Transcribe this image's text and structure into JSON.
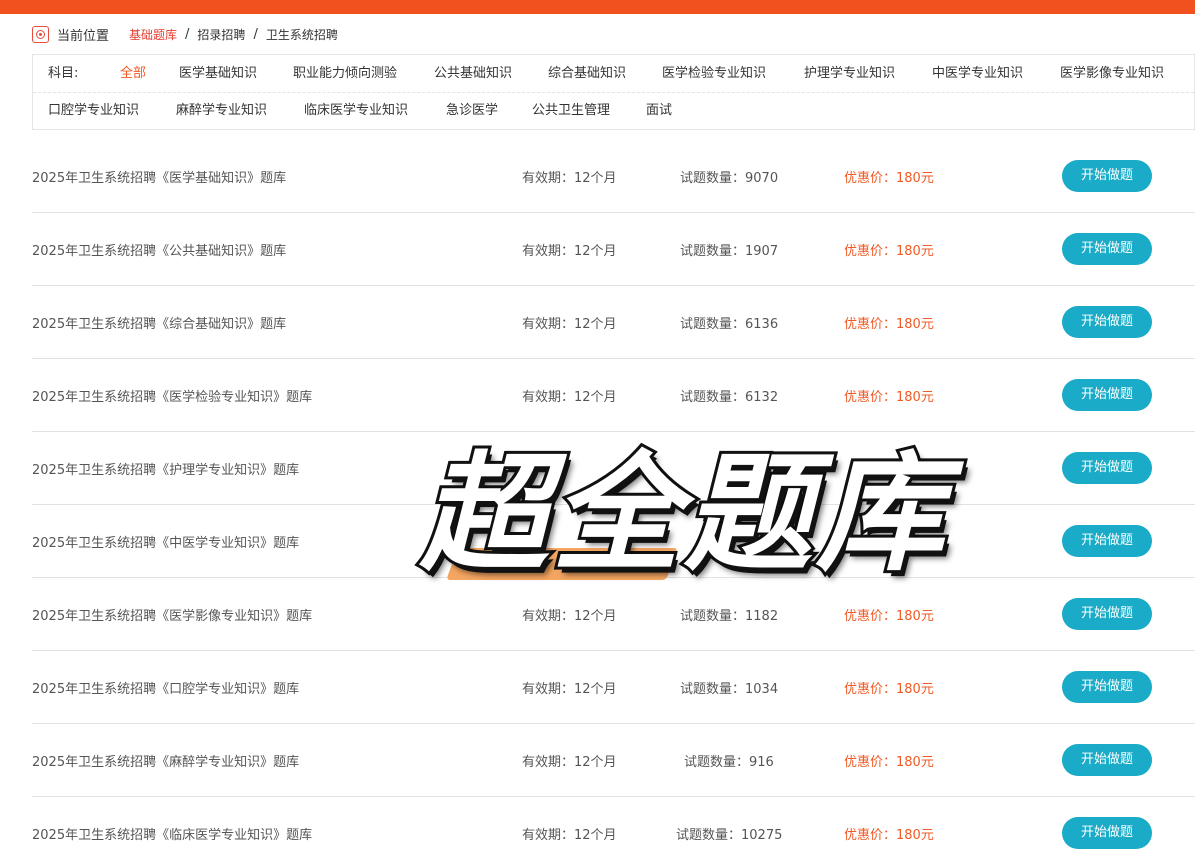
{
  "breadcrumb": {
    "current_label": "当前位置",
    "items": [
      "基础题库",
      "招录招聘",
      "卫生系统招聘"
    ],
    "separator": "/"
  },
  "filter": {
    "label": "科目:",
    "options": [
      "全部",
      "医学基础知识",
      "职业能力倾向测验",
      "公共基础知识",
      "综合基础知识",
      "医学检验专业知识",
      "护理学专业知识",
      "中医学专业知识",
      "医学影像专业知识",
      "口腔学专业知识",
      "麻醉学专业知识",
      "临床医学专业知识",
      "急诊医学",
      "公共卫生管理",
      "面试"
    ],
    "active": "全部"
  },
  "rows": [
    {
      "title": "2025年卫生系统招聘《医学基础知识》题库",
      "valid": "有效期：12个月",
      "count": "试题数量：9070",
      "price": "优惠价：180元",
      "button": "开始做题"
    },
    {
      "title": "2025年卫生系统招聘《公共基础知识》题库",
      "valid": "有效期：12个月",
      "count": "试题数量：1907",
      "price": "优惠价：180元",
      "button": "开始做题"
    },
    {
      "title": "2025年卫生系统招聘《综合基础知识》题库",
      "valid": "有效期：12个月",
      "count": "试题数量：6136",
      "price": "优惠价：180元",
      "button": "开始做题"
    },
    {
      "title": "2025年卫生系统招聘《医学检验专业知识》题库",
      "valid": "有效期：12个月",
      "count": "试题数量：6132",
      "price": "优惠价：180元",
      "button": "开始做题"
    },
    {
      "title": "2025年卫生系统招聘《护理学专业知识》题库",
      "valid": "",
      "count": "",
      "price": "",
      "button": "开始做题"
    },
    {
      "title": "2025年卫生系统招聘《中医学专业知识》题库",
      "valid": "",
      "count": "",
      "price": "",
      "button": "开始做题"
    },
    {
      "title": "2025年卫生系统招聘《医学影像专业知识》题库",
      "valid": "有效期：12个月",
      "count": "试题数量：1182",
      "price": "优惠价：180元",
      "button": "开始做题"
    },
    {
      "title": "2025年卫生系统招聘《口腔学专业知识》题库",
      "valid": "有效期：12个月",
      "count": "试题数量：1034",
      "price": "优惠价：180元",
      "button": "开始做题"
    },
    {
      "title": "2025年卫生系统招聘《麻醉学专业知识》题库",
      "valid": "有效期：12个月",
      "count": "试题数量：916",
      "price": "优惠价：180元",
      "button": "开始做题"
    },
    {
      "title": "2025年卫生系统招聘《临床医学专业知识》题库",
      "valid": "有效期：12个月",
      "count": "试题数量：10275",
      "price": "优惠价：180元",
      "button": "开始做题"
    }
  ],
  "overlay_text": "超全题库",
  "colors": {
    "accent": "#f0511f",
    "button": "#19abc7",
    "price": "#f05a24"
  }
}
